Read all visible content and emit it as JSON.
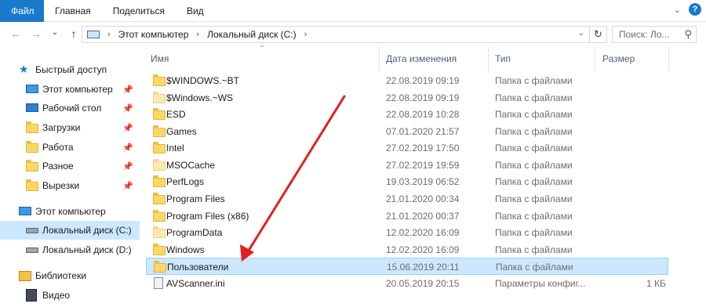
{
  "ribbon": {
    "tabs": [
      "Файл",
      "Главная",
      "Поделиться",
      "Вид"
    ]
  },
  "address": {
    "crumbs": [
      "Этот компьютер",
      "Локальный диск (C:)"
    ]
  },
  "search": {
    "placeholder": "Поиск: Ло..."
  },
  "nav": {
    "quick_access": "Быстрый доступ",
    "pinned": [
      "Этот компьютер",
      "Рабочий стол",
      "Загрузки",
      "Работа",
      "Разное",
      "Вырезки"
    ],
    "this_pc": "Этот компьютер",
    "drives": [
      "Локальный диск (C:)",
      "Локальный диск (D:)"
    ],
    "libraries": "Библиотеки",
    "video": "Видео"
  },
  "columns": {
    "name": "Имя",
    "date": "Дата изменения",
    "type": "Тип",
    "size": "Размер"
  },
  "files": [
    {
      "name": "$WINDOWS.~BT",
      "date": "22.08.2019 09:19",
      "type": "Папка с файлами",
      "size": ""
    },
    {
      "name": "$Windows.~WS",
      "date": "22.08.2019 09:19",
      "type": "Папка с файлами",
      "size": ""
    },
    {
      "name": "ESD",
      "date": "22.08.2019 10:28",
      "type": "Папка с файлами",
      "size": ""
    },
    {
      "name": "Games",
      "date": "07.01.2020 21:57",
      "type": "Папка с файлами",
      "size": ""
    },
    {
      "name": "Intel",
      "date": "27.02.2019 17:50",
      "type": "Папка с файлами",
      "size": ""
    },
    {
      "name": "MSOCache",
      "date": "27.02.2019 19:59",
      "type": "Папка с файлами",
      "size": ""
    },
    {
      "name": "PerfLogs",
      "date": "19.03.2019 06:52",
      "type": "Папка с файлами",
      "size": ""
    },
    {
      "name": "Program Files",
      "date": "21.01.2020 00:34",
      "type": "Папка с файлами",
      "size": ""
    },
    {
      "name": "Program Files (x86)",
      "date": "21.01.2020 00:37",
      "type": "Папка с файлами",
      "size": ""
    },
    {
      "name": "ProgramData",
      "date": "12.02.2020 16:09",
      "type": "Папка с файлами",
      "size": ""
    },
    {
      "name": "Windows",
      "date": "12.02.2020 16:09",
      "type": "Папка с файлами",
      "size": ""
    },
    {
      "name": "Пользователи",
      "date": "15.06.2019 20:11",
      "type": "Папка с файлами",
      "size": ""
    },
    {
      "name": "AVScanner.ini",
      "date": "20.05.2019 20:15",
      "type": "Параметры конфиг...",
      "size": "1 КБ"
    }
  ],
  "colors": {
    "accent": "#1979ca",
    "selection": "#cce8ff",
    "folder": "#ffd766",
    "annotation_arrow": "#e02020"
  }
}
